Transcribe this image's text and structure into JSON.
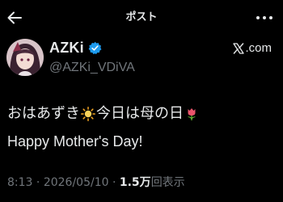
{
  "header": {
    "title": "ポスト",
    "back_icon": "arrow-left-icon",
    "more_icon": "more-horizontal-icon"
  },
  "author": {
    "display_name": "AZKi",
    "handle": "@AZKi_VDiVA",
    "verified": true,
    "verified_color": "#1d9bf0",
    "avatar": "avatar-image"
  },
  "source": {
    "label": ".com",
    "icon": "x-logo-icon"
  },
  "tweet": {
    "line1_a": "おはあずき",
    "line1_emoji": "sun-emoji",
    "line1_b": "今日は母の日",
    "line1_emoji2": "tulip-emoji",
    "line2": "Happy Mother's Day!"
  },
  "meta": {
    "time": "8:13",
    "separator1": " · ",
    "date": "2026/05/10",
    "separator2": " · ",
    "views_count": "1.5万",
    "views_label": "回表示"
  },
  "colors": {
    "background": "#000000",
    "text_primary": "#e7e9ea",
    "text_secondary": "#71767b"
  }
}
